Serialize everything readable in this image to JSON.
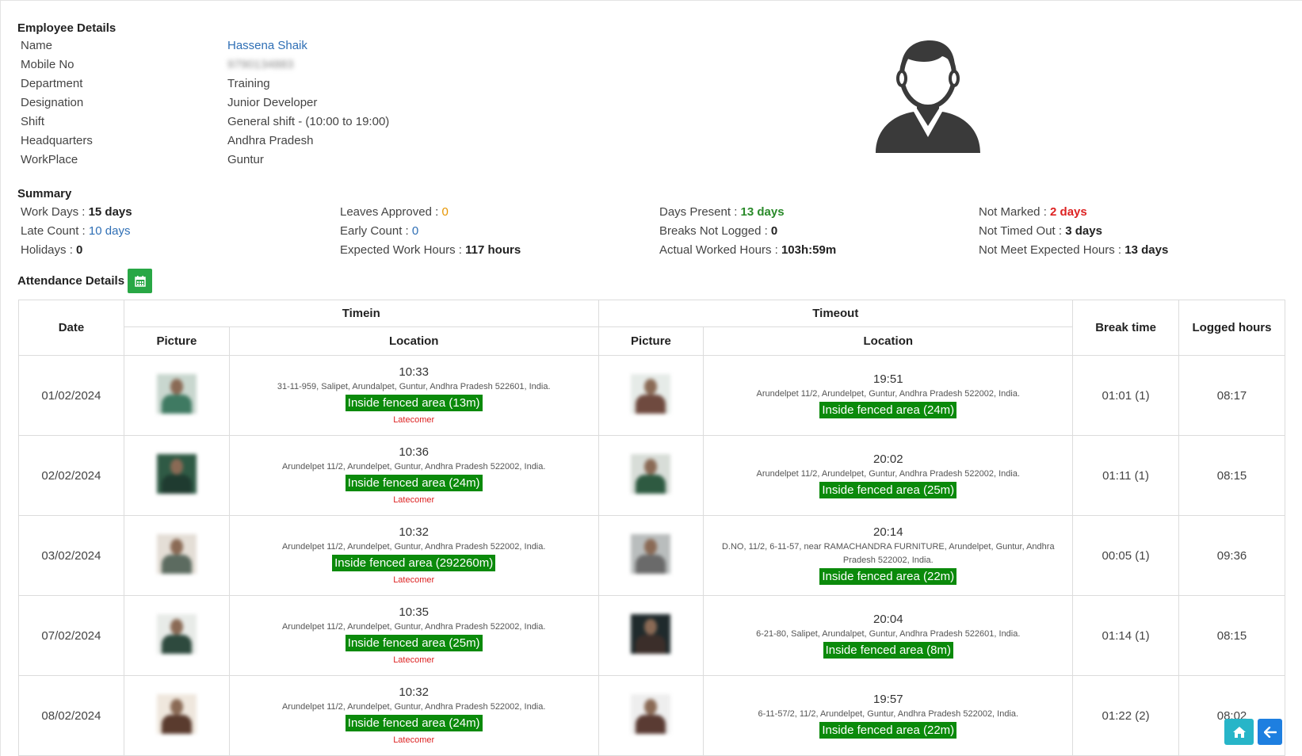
{
  "employee": {
    "heading": "Employee Details",
    "fields": [
      {
        "label": "Name",
        "value": "Hassena Shaik",
        "style": "link"
      },
      {
        "label": "Mobile No",
        "value": "9790134883",
        "style": "blurred"
      },
      {
        "label": "Department",
        "value": "Training",
        "style": ""
      },
      {
        "label": "Designation",
        "value": "Junior Developer",
        "style": ""
      },
      {
        "label": "Shift",
        "value": "General shift - (10:00 to 19:00)",
        "style": ""
      },
      {
        "label": "Headquarters",
        "value": "Andhra Pradesh",
        "style": ""
      },
      {
        "label": "WorkPlace",
        "value": "Guntur",
        "style": ""
      }
    ]
  },
  "summary": {
    "heading": "Summary",
    "items": [
      {
        "label": "Work Days : ",
        "value": "15 days",
        "cls": "bold"
      },
      {
        "label": "Leaves Approved : ",
        "value": "0",
        "cls": "c-orange"
      },
      {
        "label": "Days Present : ",
        "value": "13 days",
        "cls": "c-green"
      },
      {
        "label": "Not Marked : ",
        "value": "2 days",
        "cls": "c-red"
      },
      {
        "label": "Late Count : ",
        "value": "10 days",
        "cls": "c-blue"
      },
      {
        "label": "Early Count : ",
        "value": "0",
        "cls": "c-blue"
      },
      {
        "label": "Breaks Not Logged : ",
        "value": "0",
        "cls": "bold"
      },
      {
        "label": "Not Timed Out : ",
        "value": "3 days",
        "cls": "bold"
      },
      {
        "label": "Holidays : ",
        "value": "0",
        "cls": "bold"
      },
      {
        "label": "Expected Work Hours : ",
        "value": "117 hours",
        "cls": "bold"
      },
      {
        "label": "Actual Worked Hours : ",
        "value": "103h:59m",
        "cls": "bold"
      },
      {
        "label": "Not Meet Expected Hours : ",
        "value": "13 days",
        "cls": "bold"
      }
    ]
  },
  "attendance": {
    "heading": "Attendance Details",
    "calendar_icon": "calendar-icon",
    "headers": {
      "date": "Date",
      "timein": "Timein",
      "timeout": "Timeout",
      "picture": "Picture",
      "location": "Location",
      "break_time": "Break time",
      "logged_hours": "Logged hours"
    },
    "rows": [
      {
        "date": "01/02/2024",
        "in_time": "10:33",
        "in_addr": "31-11-959, Salipet, Arundalpet, Guntur, Andhra Pradesh 522601, India.",
        "in_fence": "Inside fenced area (13m)",
        "in_note": "Latecomer",
        "out_time": "19:51",
        "out_addr": "Arundelpet 11/2, Arundelpet, Guntur, Andhra Pradesh 522002, India.",
        "out_fence": "Inside fenced area (24m)",
        "break": "01:01 (1)",
        "logged": "08:17",
        "in_pic": [
          "#c9d7cf",
          "#3f7a62"
        ],
        "out_pic": [
          "#e6ebe8",
          "#6f4a3f"
        ]
      },
      {
        "date": "02/02/2024",
        "in_time": "10:36",
        "in_addr": "Arundelpet 11/2, Arundelpet, Guntur, Andhra Pradesh 522002, India.",
        "in_fence": "Inside fenced area (24m)",
        "in_note": "Latecomer",
        "out_time": "20:02",
        "out_addr": "Arundelpet 11/2, Arundelpet, Guntur, Andhra Pradesh 522002, India.",
        "out_fence": "Inside fenced area (25m)",
        "break": "01:11 (1)",
        "logged": "08:15",
        "in_pic": [
          "#2f5a45",
          "#1f3b30"
        ],
        "out_pic": [
          "#d8ddd8",
          "#2e5a41"
        ]
      },
      {
        "date": "03/02/2024",
        "in_time": "10:32",
        "in_addr": "Arundelpet 11/2, Arundelpet, Guntur, Andhra Pradesh 522002, India.",
        "in_fence": "Inside fenced area (292260m)",
        "in_note": "Latecomer",
        "out_time": "20:14",
        "out_addr": "D.NO, 11/2, 6-11-57, near RAMACHANDRA FURNITURE, Arundelpet, Guntur, Andhra Pradesh 522002, India.",
        "out_fence": "Inside fenced area (22m)",
        "break": "00:05 (1)",
        "logged": "09:36",
        "in_pic": [
          "#e4ded6",
          "#5c6b60"
        ],
        "out_pic": [
          "#b9bdbd",
          "#6a6a6a"
        ]
      },
      {
        "date": "07/02/2024",
        "in_time": "10:35",
        "in_addr": "Arundelpet 11/2, Arundelpet, Guntur, Andhra Pradesh 522002, India.",
        "in_fence": "Inside fenced area (25m)",
        "in_note": "Latecomer",
        "out_time": "20:04",
        "out_addr": "6-21-80, Salipet, Arundalpet, Guntur, Andhra Pradesh 522601, India.",
        "out_fence": "Inside fenced area (8m)",
        "break": "01:14 (1)",
        "logged": "08:15",
        "in_pic": [
          "#e8ebe8",
          "#2e4a3e"
        ],
        "out_pic": [
          "#1f2a2c",
          "#3b2e2a"
        ]
      },
      {
        "date": "08/02/2024",
        "in_time": "10:32",
        "in_addr": "Arundelpet 11/2, Arundelpet, Guntur, Andhra Pradesh 522002, India.",
        "in_fence": "Inside fenced area (24m)",
        "in_note": "Latecomer",
        "out_time": "19:57",
        "out_addr": "6-11-57/2, 11/2, Arundelpet, Guntur, Andhra Pradesh 522002, India.",
        "out_fence": "Inside fenced area (22m)",
        "break": "01:22 (2)",
        "logged": "08:02",
        "in_pic": [
          "#efe7dd",
          "#5a3b2e"
        ],
        "out_pic": [
          "#eeeeee",
          "#5a3b33"
        ]
      }
    ]
  },
  "fabs": {
    "home_icon": "home-icon",
    "back_icon": "arrow-left-icon"
  },
  "colors": {
    "fence": "#0b8a0b",
    "calendar_btn": "#28a745",
    "home_btn": "#27b5c8",
    "back_btn": "#1e7fe0",
    "link": "#2f6fb5"
  }
}
